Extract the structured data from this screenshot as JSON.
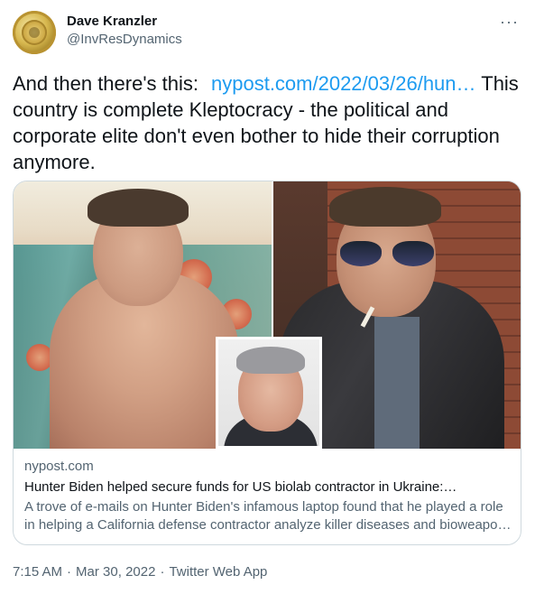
{
  "author": {
    "display_name": "Dave Kranzler",
    "handle": "@InvResDynamics"
  },
  "tweet": {
    "text_intro": "And then there's this:",
    "link_text": "nypost.com/2022/03/26/hun…",
    "text_body": "This country is complete Kleptocracy - the political and corporate elite don't even bother to hide their corruption anymore."
  },
  "card": {
    "domain": "nypost.com",
    "title": "Hunter Biden helped secure funds for US biolab contractor in Ukraine:…",
    "description_line1": "A trove of e-mails on Hunter Biden's infamous laptop found that he played a role",
    "description_line2": "in helping a California defense contractor analyze killer diseases and bioweapo…"
  },
  "meta": {
    "time": "7:15 AM",
    "date": "Mar 30, 2022",
    "source": "Twitter Web App",
    "separator": "·"
  },
  "icons": {
    "more": "more-horizontal-icon"
  },
  "colors": {
    "link": "#1d9bf0",
    "secondary_text": "#536471",
    "primary_text": "#0f1419",
    "border": "#cfd9de"
  }
}
